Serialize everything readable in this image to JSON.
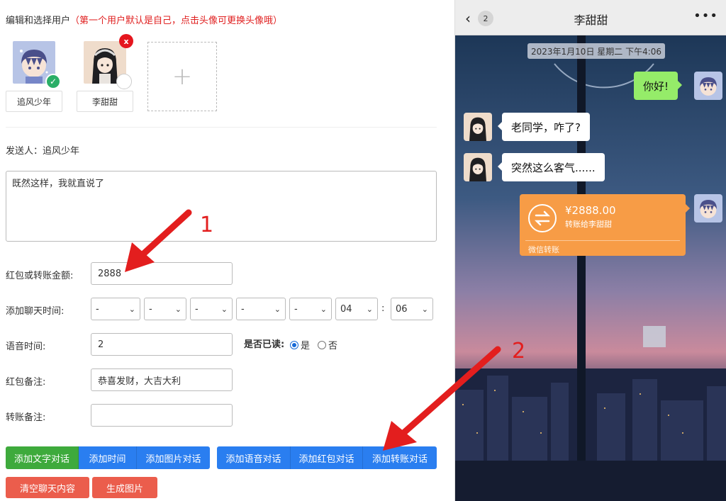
{
  "editor": {
    "heading": "编辑和选择用户",
    "heading_hint": "（第一个用户默认是自己，点击头像可更换头像哦）",
    "users": [
      {
        "name": "追风少年",
        "selected": true
      },
      {
        "name": "李甜甜",
        "selected": false
      }
    ],
    "add_user_symbol": "+",
    "delete_symbol": "x",
    "sender_label": "发送人：追风少年",
    "message_text": "既然这样，我就直说了",
    "amount_label": "红包或转账金额:",
    "amount_value": "2888",
    "time_label": "添加聊天时间:",
    "time_selects": [
      "-",
      "-",
      "-",
      "-",
      "-",
      "04",
      "06"
    ],
    "time_colon": ":",
    "voice_label": "语音时间:",
    "voice_value": "2",
    "read_label": "是否已读:",
    "read_options": [
      "是",
      "否"
    ],
    "read_selected": "是",
    "redpacket_note_label": "红包备注:",
    "redpacket_note_value": "恭喜发财，大吉大利",
    "transfer_note_label": "转账备注:",
    "transfer_note_value": "",
    "buttons_group1": [
      "添加文字对话",
      "添加时间",
      "添加图片对话"
    ],
    "buttons_group2": [
      "添加语音对话",
      "添加红包对话",
      "添加转账对话"
    ],
    "clear_button": "清空聊天内容",
    "generate_button": "生成图片",
    "annotations": [
      "1",
      "2"
    ]
  },
  "phone": {
    "title": "李甜甜",
    "back_count": "2",
    "more_icon": "•••",
    "timestamp": "2023年1月10日 星期二 下午4:06",
    "messages": [
      {
        "from": "me",
        "text": "你好!"
      },
      {
        "from": "them",
        "text": "老同学，咋了?"
      },
      {
        "from": "them",
        "text": "突然这么客气......"
      }
    ],
    "transfer": {
      "amount": "¥2888.00",
      "to": "转账给李甜甜",
      "footer": "微信转账"
    }
  },
  "colors": {
    "accent_blue": "#2a7ef0",
    "green": "#3eaa3c",
    "red_button": "#eb5d4c",
    "transfer_orange": "#f79c46",
    "bubble_green": "#95ec69",
    "annotation_red": "#e31e1e"
  }
}
